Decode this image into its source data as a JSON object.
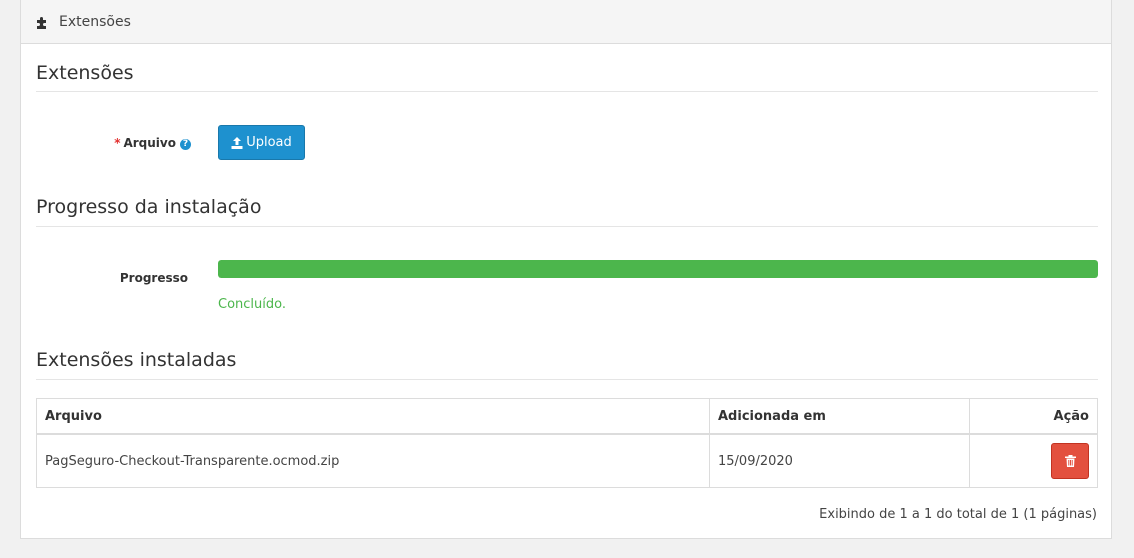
{
  "header": {
    "title": "Extensões",
    "icon": "puzzle-icon"
  },
  "sections": {
    "upload_title": "Extensões",
    "progress_title": "Progresso da instalação",
    "installed_title": "Extensões instaladas"
  },
  "upload": {
    "required_mark": "*",
    "label": "Arquivo",
    "help_icon": "?",
    "button_label": "Upload",
    "button_icon": "upload-icon"
  },
  "progress": {
    "label": "Progresso",
    "percent": 100,
    "status_text": "Concluído.",
    "color": "#4cb64c"
  },
  "table": {
    "columns": [
      "Arquivo",
      "Adicionada em",
      "Ação"
    ],
    "rows": [
      {
        "file": "PagSeguro-Checkout-Transparente.ocmod.zip",
        "added": "15/09/2020",
        "action_icon": "trash-icon"
      }
    ]
  },
  "pagination": {
    "summary": "Exibindo de 1 a 1 do total de 1 (1 páginas)"
  },
  "colors": {
    "primary": "#1e91cf",
    "danger": "#e3503e",
    "success": "#4cb64c"
  }
}
